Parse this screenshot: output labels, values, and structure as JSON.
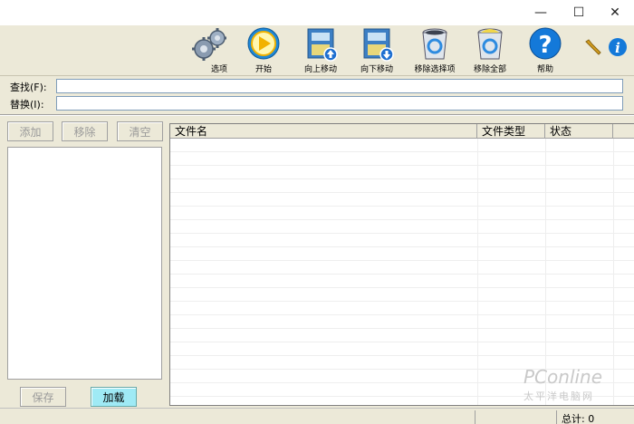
{
  "window": {
    "minimize_glyph": "—",
    "maximize_glyph": "☐",
    "close_glyph": "✕"
  },
  "toolbar": {
    "options": "选项",
    "start": "开始",
    "move_up": "向上移动",
    "move_down": "向下移动",
    "remove_selected": "移除选择项",
    "remove_all": "移除全部",
    "help": "帮助"
  },
  "find": {
    "find_label": "查找(F):",
    "find_value": "",
    "replace_label": "替换(I):",
    "replace_value": ""
  },
  "left_panel": {
    "add": "添加",
    "remove": "移除",
    "clear": "清空",
    "save": "保存",
    "load": "加载"
  },
  "table": {
    "columns": [
      "文件名",
      "文件类型",
      "状态"
    ]
  },
  "status": {
    "total": "总计: 0"
  },
  "watermark": {
    "brand": "PConline",
    "sub": "太平洋电脑网"
  },
  "colors": {
    "panel": "#ECE9D8",
    "load_button": "#9FEAF5"
  }
}
